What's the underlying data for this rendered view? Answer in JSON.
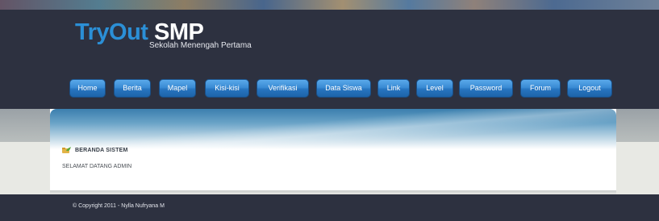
{
  "header": {
    "title_part1": "TryOut",
    "title_part2": "SMP",
    "subtitle": "Sekolah Menengah Pertama"
  },
  "nav": {
    "items": [
      {
        "label": "Home"
      },
      {
        "label": "Berita"
      },
      {
        "label": "Mapel"
      },
      {
        "label": "Kisi-kisi"
      },
      {
        "label": "Verifikasi"
      },
      {
        "label": "Data Siswa"
      },
      {
        "label": "Link"
      },
      {
        "label": "Level"
      },
      {
        "label": "Password"
      },
      {
        "label": "Forum"
      },
      {
        "label": "Logout"
      }
    ]
  },
  "main": {
    "section_icon": "folder-leaf-icon",
    "section_title": "BERANDA SISTEM",
    "welcome_text": "SELAMAT DATANG ADMIN"
  },
  "footer": {
    "copyright": "© Copyright 2011 - Nylla Nufryana M"
  },
  "colors": {
    "header_bg": "#2d3140",
    "logo_accent": "#2b8fd6",
    "nav_button": "#3a8bd4",
    "page_bg": "#e8e9e4"
  }
}
